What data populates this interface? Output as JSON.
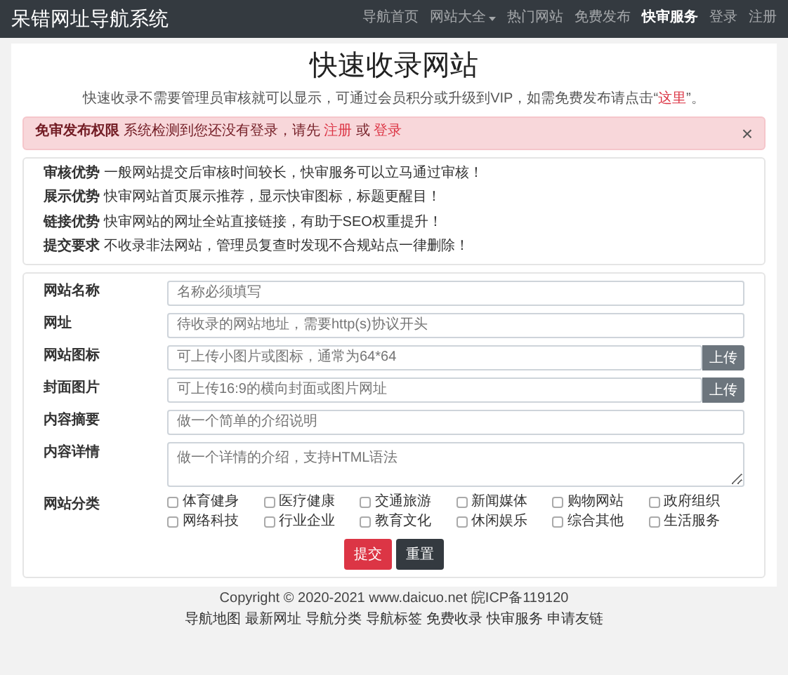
{
  "navbar": {
    "brand": "呆错网址导航系统",
    "items": [
      {
        "label": "导航首页",
        "selected": false,
        "dropdown": false
      },
      {
        "label": "网站大全",
        "selected": false,
        "dropdown": true
      },
      {
        "label": "热门网站",
        "selected": false,
        "dropdown": false
      },
      {
        "label": "免费发布",
        "selected": false,
        "dropdown": false
      },
      {
        "label": "快审服务",
        "selected": true,
        "dropdown": false
      },
      {
        "label": "登录",
        "selected": false,
        "dropdown": false
      },
      {
        "label": "注册",
        "selected": false,
        "dropdown": false
      }
    ]
  },
  "page": {
    "title": "快速收录网站",
    "subtitle": "快速收录不需要管理员审核就可以显示，可通过会员积分或升级到VIP，如需免费发布请点击“",
    "subtitle_link": "这里",
    "subtitle_end": "”。"
  },
  "alert": {
    "title": "免审发布权限",
    "text": "系统检测到您还没有登录，请先",
    "link_1": "注册",
    "separator": "或",
    "link_2": "登录",
    "close": "×"
  },
  "advantages": [
    {
      "label": "审核优势",
      "text": "一般网站提交后审核时间较长，快审服务可以立马通过审核！"
    },
    {
      "label": "展示优势",
      "text": "快审网站首页展示推荐，显示快审图标，标题更醒目！"
    },
    {
      "label": "链接优势",
      "text": "快审网站的网址全站直接链接，有助于SEO权重提升！"
    },
    {
      "label": "提交要求",
      "text": "不收录非法网站，管理员复查时发现不合规站点一律删除！"
    }
  ],
  "form": {
    "fields": [
      {
        "label": "网站名称",
        "kind": "input",
        "placeholder": "名称必须填写"
      },
      {
        "label": "网址",
        "kind": "input",
        "placeholder": "待收录的网站地址，需要http(s)协议开头"
      },
      {
        "label": "网站图标",
        "kind": "upload",
        "placeholder": "可上传小图片或图标，通常为64*64",
        "button": "上传"
      },
      {
        "label": "封面图片",
        "kind": "upload",
        "placeholder": "可上传16:9的横向封面或图片网址",
        "button": "上传"
      },
      {
        "label": "内容摘要",
        "kind": "input",
        "placeholder": "做一个简单的介绍说明"
      },
      {
        "label": "内容详情",
        "kind": "textarea",
        "placeholder": "做一个详情的介绍，支持HTML语法"
      }
    ],
    "categories": {
      "label": "网站分类",
      "options": [
        {
          "label": "体育健身",
          "checked": false
        },
        {
          "label": "医疗健康",
          "checked": false
        },
        {
          "label": "交通旅游",
          "checked": false
        },
        {
          "label": "新闻媒体",
          "checked": false
        },
        {
          "label": "购物网站",
          "checked": false
        },
        {
          "label": "政府组织",
          "checked": false
        },
        {
          "label": "网络科技",
          "checked": false
        },
        {
          "label": "行业企业",
          "checked": false
        },
        {
          "label": "教育文化",
          "checked": false
        },
        {
          "label": "休闲娱乐",
          "checked": false
        },
        {
          "label": "综合其他",
          "checked": false
        },
        {
          "label": "生活服务",
          "checked": false
        }
      ]
    },
    "buttons": [
      {
        "label": "提交",
        "kind": "danger"
      },
      {
        "label": "重置",
        "kind": "dark"
      }
    ]
  },
  "footer": {
    "copyright": "Copyright © 2020-2021 www.daicuo.net 皖ICP备119120",
    "links": [
      "导航地图",
      "最新网址",
      "导航分类",
      "导航标签",
      "免费收录",
      "快审服务",
      "申请友链"
    ]
  }
}
